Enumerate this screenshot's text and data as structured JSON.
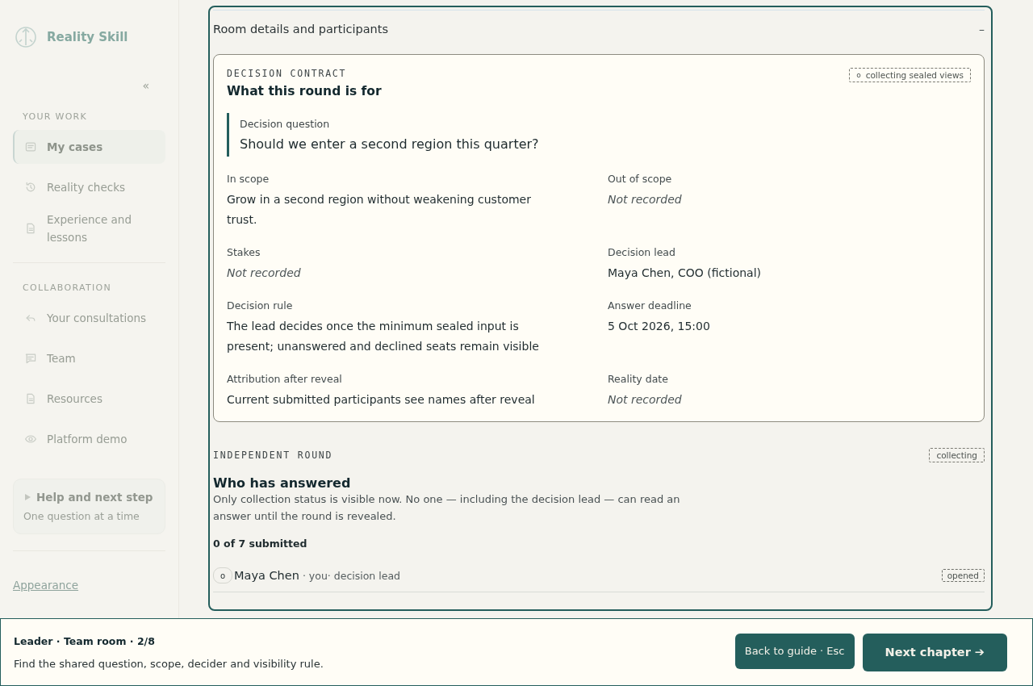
{
  "sidebar": {
    "brand": "Reality Skill",
    "collapse": "«",
    "sections": [
      {
        "heading": "YOUR WORK",
        "items": [
          {
            "label": "My cases",
            "selected": true
          },
          {
            "label": "Reality checks",
            "selected": false
          },
          {
            "label": "Experience and lessons",
            "selected": false
          }
        ]
      },
      {
        "heading": "COLLABORATION",
        "items": [
          {
            "label": "Your consultations",
            "selected": false
          },
          {
            "label": "Team",
            "selected": false
          },
          {
            "label": "Resources",
            "selected": false
          },
          {
            "label": "Platform demo",
            "selected": false
          }
        ]
      }
    ],
    "help": {
      "title": "Help and next step",
      "subtitle": "One question at a time",
      "expanded": false
    },
    "appearance_link": "Appearance"
  },
  "main": {
    "panel": {
      "title": "Room details and participants",
      "toggle": "–",
      "contract": {
        "eyebrow": "DECISION CONTRACT",
        "title": "What this round is for",
        "badge": "collecting sealed views",
        "badge_marker": "o",
        "question_label": "Decision question",
        "question": "Should we enter a second region this quarter?",
        "fields": [
          {
            "label": "In scope",
            "value": "Grow in a second region without weakening customer trust.",
            "missing": false
          },
          {
            "label": "Out of scope",
            "value": "Not recorded",
            "missing": true
          },
          {
            "label": "Stakes",
            "value": "Not recorded",
            "missing": true
          },
          {
            "label": "Decision lead",
            "value": "Maya Chen, COO (fictional)",
            "missing": false
          },
          {
            "label": "Decision rule",
            "value": "The lead decides once the minimum sealed input is present; unanswered and declined seats remain visible",
            "missing": false
          },
          {
            "label": "Answer deadline",
            "value": "5 Oct 2026, 15:00",
            "missing": false
          },
          {
            "label": "Attribution after reveal",
            "value": "Current submitted participants see names after reveal",
            "missing": false
          },
          {
            "label": "Reality date",
            "value": "Not recorded",
            "missing": true
          }
        ]
      },
      "round": {
        "eyebrow": "INDEPENDENT ROUND",
        "badge": "collecting",
        "title": "Who has answered",
        "description": "Only collection status is visible now. No one — including the decision lead — can read an answer until the round is revealed.",
        "count": "0 of 7 submitted",
        "participants": [
          {
            "marker": "o",
            "name": "Maya Chen",
            "role": "· you· decision lead",
            "status": "opened"
          }
        ]
      }
    }
  },
  "tour": {
    "step": "Leader · Team room · 2/8",
    "instruction": "Find the shared question, scope, decider and visibility rule.",
    "buttons": [
      {
        "label": "Back to guide · Esc",
        "kind": "secondary"
      },
      {
        "label": "Next chapter ➔",
        "kind": "primary"
      }
    ]
  }
}
